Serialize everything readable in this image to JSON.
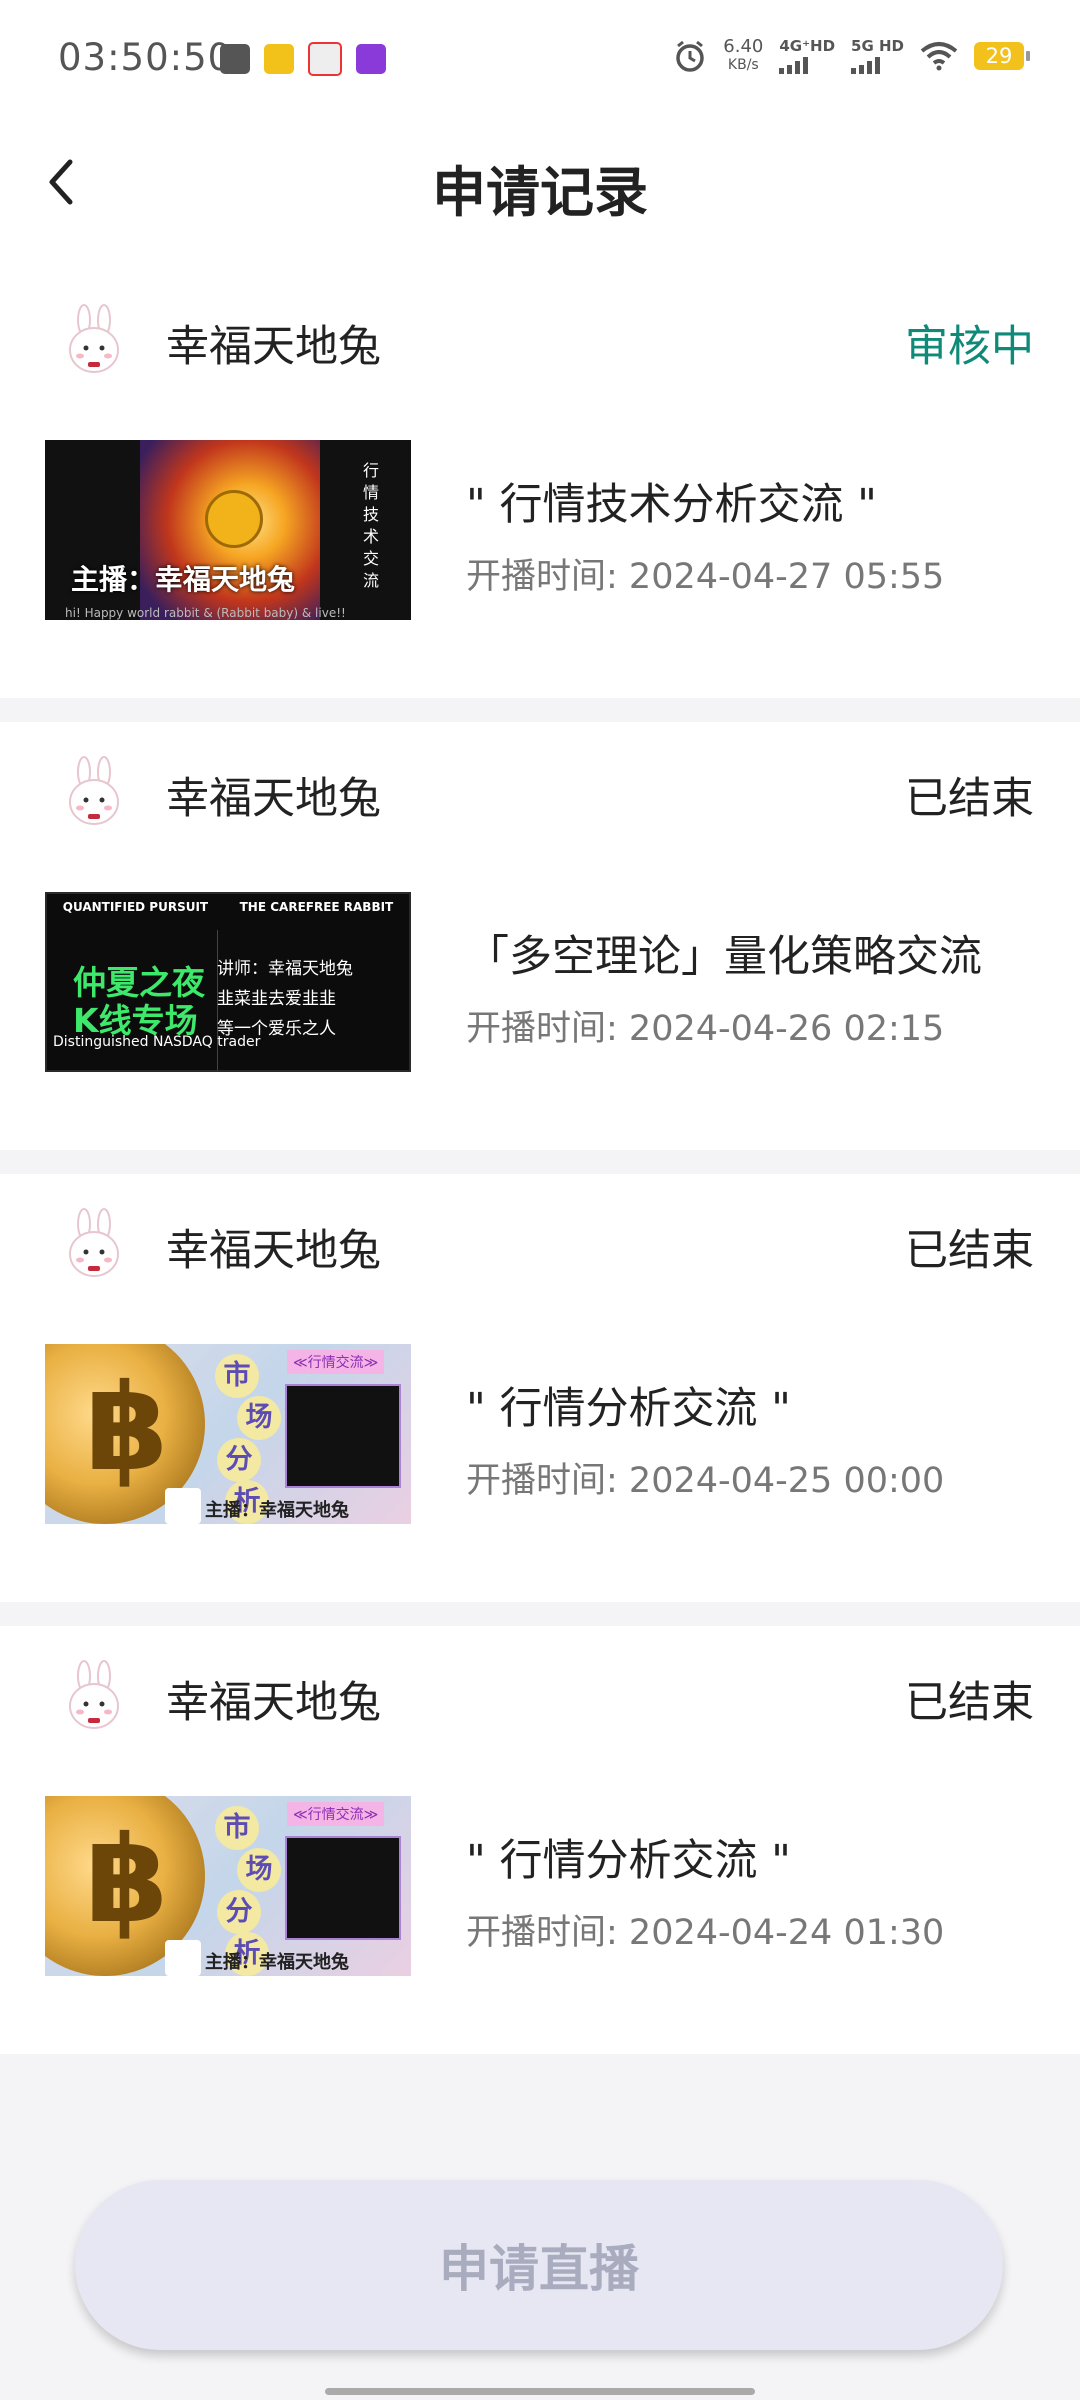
{
  "statusbar": {
    "time": "03:50:50",
    "net_speed": "6.40",
    "net_unit": "KB/s",
    "sig1": "4G⁺HD",
    "sig2": "5G HD",
    "battery": "29"
  },
  "header": {
    "title": "申请记录"
  },
  "records": [
    {
      "host": "幸福天地兔",
      "status": "审核中",
      "status_color": "#0f8a78",
      "title": "\" 行情技术分析交流 \"",
      "time_label": "开播时间: ",
      "time": "2024-04-27 05:55"
    },
    {
      "host": "幸福天地兔",
      "status": "已结束",
      "status_color": "#222222",
      "title": "「多空理论」量化策略交流",
      "time_label": "开播时间: ",
      "time": "2024-04-26 02:15"
    },
    {
      "host": "幸福天地兔",
      "status": "已结束",
      "status_color": "#222222",
      "title": "\" 行情分析交流 \"",
      "time_label": "开播时间: ",
      "time": "2024-04-25 00:00"
    },
    {
      "host": "幸福天地兔",
      "status": "已结束",
      "status_color": "#222222",
      "title": "\" 行情分析交流 \"",
      "time_label": "开播时间: ",
      "time": "2024-04-24 01:30"
    }
  ],
  "thumbs": {
    "sun_caption": "主播：幸福天地兔",
    "sun_vertical": "行情技术交流",
    "sun_ticker": "hi! Happy world rabbit & (Rabbit baby) & live!!",
    "k_top_left": "QUANTIFIED PURSUIT",
    "k_top_right": "THE CAREFREE RABBIT",
    "k_green": "仲夏之夜\nK线专场",
    "k_sub": "Distinguished NASDAQ trader",
    "k_right": "讲师：幸福天地兔\n韭菜韭去爱韭韭\n等一个爱乐之人",
    "btc_tag": "≪行情交流≫",
    "btc_bubbles": [
      "市",
      "场",
      "分",
      "析"
    ],
    "btc_host": "主播：幸福天地兔"
  },
  "footer": {
    "apply_label": "申请直播"
  }
}
